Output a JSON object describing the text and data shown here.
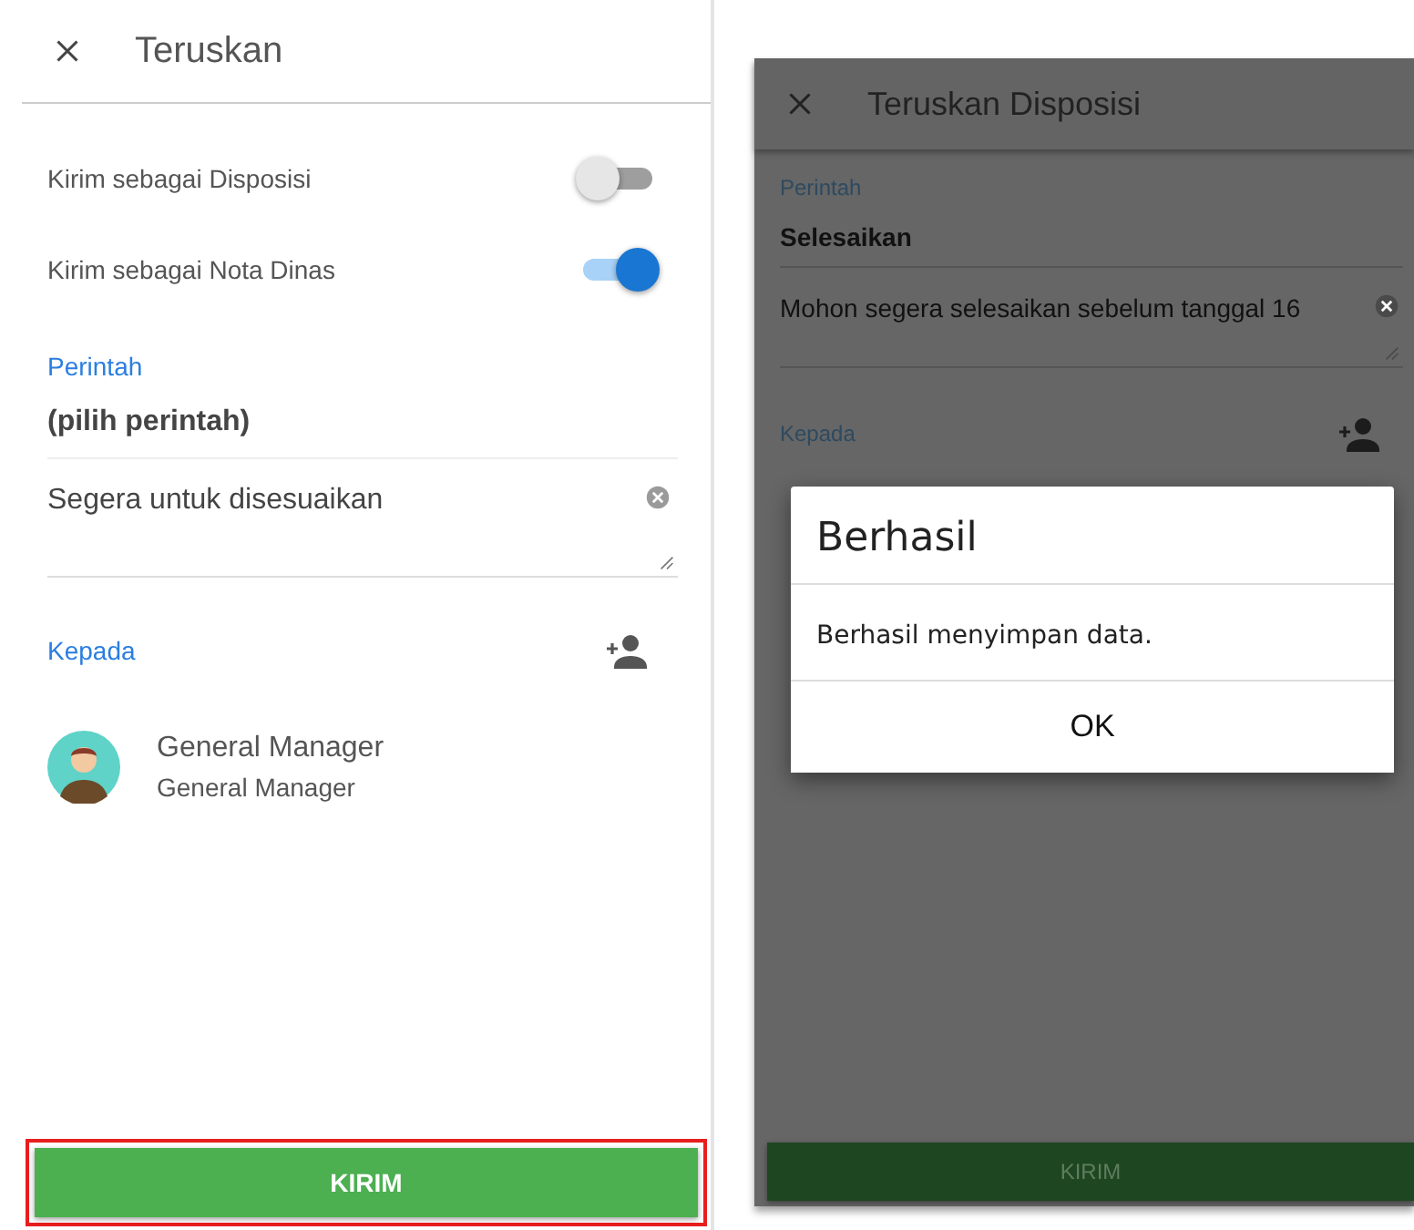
{
  "left_screen": {
    "header": {
      "title": "Teruskan"
    },
    "toggles": [
      {
        "label": "Kirim sebagai Disposisi",
        "on": false
      },
      {
        "label": "Kirim sebagai Nota Dinas",
        "on": true
      }
    ],
    "perintah": {
      "label": "Perintah",
      "value": "(pilih perintah)"
    },
    "message": {
      "value": "Segera untuk disesuaikan"
    },
    "recipients": {
      "label": "Kepada",
      "items": [
        {
          "name": "General Manager",
          "position": "General Manager"
        }
      ]
    },
    "submit_button": {
      "label": "KIRIM",
      "highlighted": true
    }
  },
  "right_screen": {
    "header": {
      "title": "Teruskan Disposisi"
    },
    "perintah": {
      "label": "Perintah",
      "value": "Selesaikan"
    },
    "message": {
      "value": "Mohon segera selesaikan sebelum tanggal 16"
    },
    "recipients": {
      "label": "Kepada"
    },
    "submit_button": {
      "label": "KIRIM",
      "disabled": true
    },
    "dialog": {
      "title": "Berhasil",
      "message": "Berhasil menyimpan data.",
      "button": "OK"
    }
  }
}
